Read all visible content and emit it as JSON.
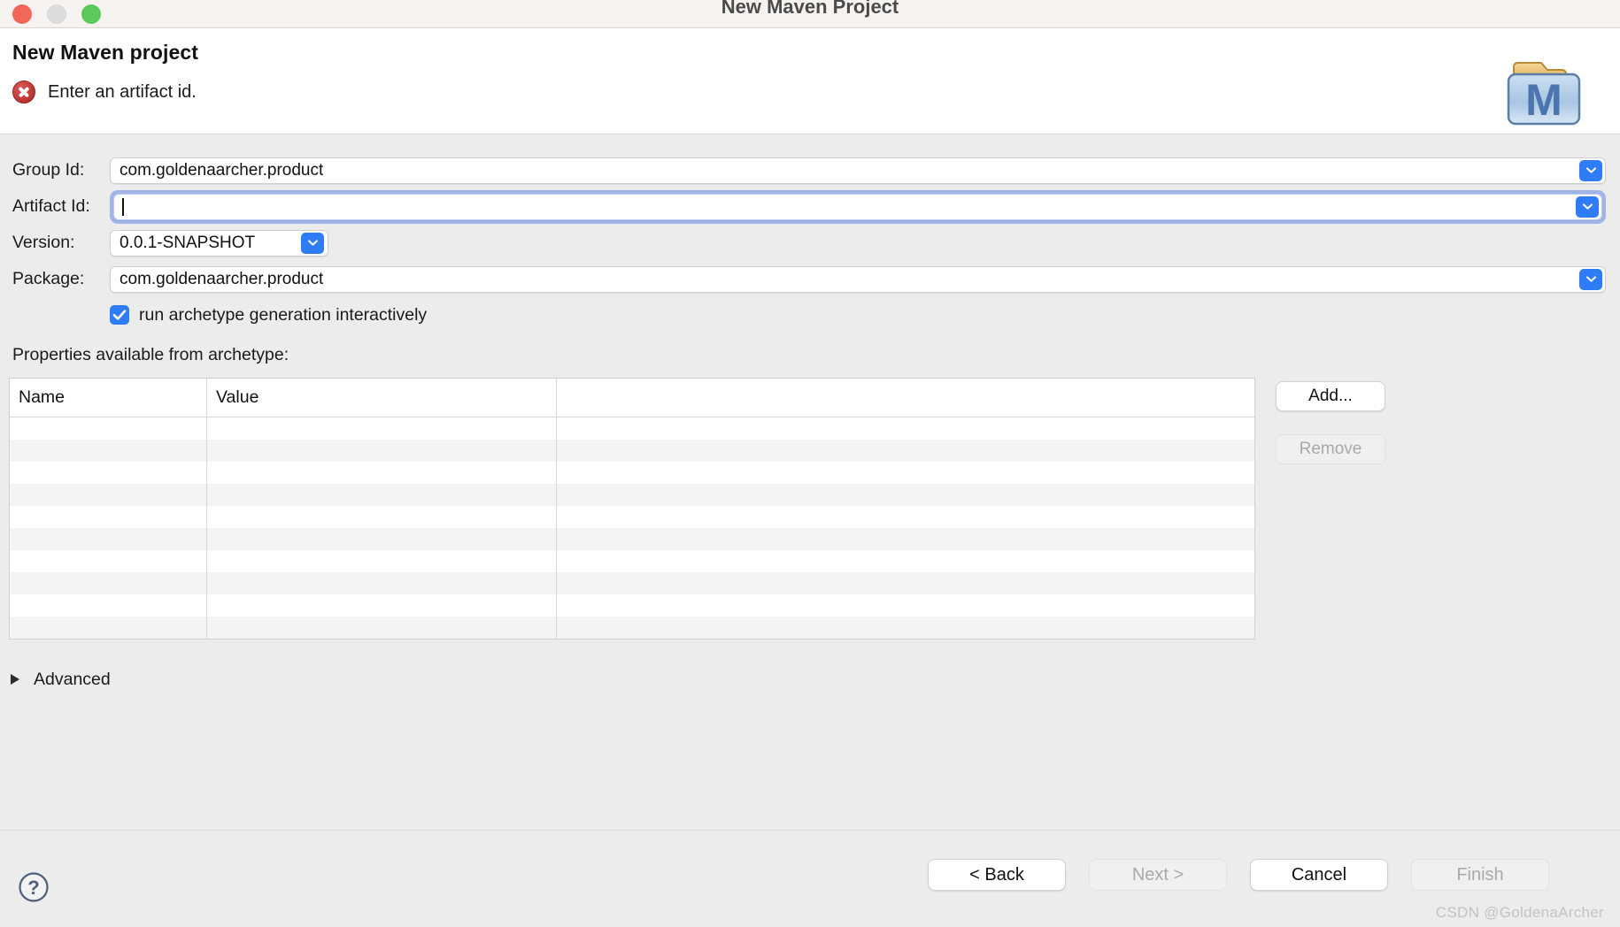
{
  "window": {
    "title": "New Maven Project",
    "traffic_lights": [
      "close-button",
      "minimize-button",
      "maximize-button"
    ]
  },
  "header": {
    "heading": "New Maven project",
    "status_icon": "error-icon",
    "status_message": "Enter an artifact id.",
    "logo_icon": "maven-folder-icon",
    "logo_letter": "M"
  },
  "form": {
    "fields": [
      {
        "label": "Group Id:",
        "value": "com.goldenaarcher.product",
        "has_dropdown": true,
        "focused": false
      },
      {
        "label": "Artifact Id:",
        "value": "",
        "has_dropdown": true,
        "focused": true
      },
      {
        "label": "Version:",
        "value": "0.0.1-SNAPSHOT",
        "has_dropdown": true,
        "focused": false
      },
      {
        "label": "Package:",
        "value": "com.goldenaarcher.product",
        "has_dropdown": true,
        "focused": false
      }
    ],
    "checkbox": {
      "label": "run archetype generation interactively",
      "checked": true
    }
  },
  "properties": {
    "section_label": "Properties available from archetype:",
    "columns": [
      "Name",
      "Value",
      ""
    ],
    "rows": [
      {
        "name": "",
        "value": "",
        "extra": ""
      },
      {
        "name": "",
        "value": "",
        "extra": ""
      },
      {
        "name": "",
        "value": "",
        "extra": ""
      },
      {
        "name": "",
        "value": "",
        "extra": ""
      },
      {
        "name": "",
        "value": "",
        "extra": ""
      },
      {
        "name": "",
        "value": "",
        "extra": ""
      },
      {
        "name": "",
        "value": "",
        "extra": ""
      },
      {
        "name": "",
        "value": "",
        "extra": ""
      },
      {
        "name": "",
        "value": "",
        "extra": ""
      },
      {
        "name": "",
        "value": "",
        "extra": ""
      }
    ],
    "add_label": "Add...",
    "remove_label": "Remove",
    "remove_enabled": false
  },
  "advanced": {
    "label": "Advanced",
    "expanded": false,
    "disclosure_icon": "triangle-right-icon"
  },
  "footer": {
    "help_icon": "help-question-icon",
    "buttons": [
      {
        "label": "< Back",
        "enabled": true
      },
      {
        "label": "Next >",
        "enabled": false
      },
      {
        "label": "Cancel",
        "enabled": true
      },
      {
        "label": "Finish",
        "enabled": false
      }
    ]
  },
  "watermark": "CSDN @GoldenaArcher",
  "colors": {
    "accent_blue": "#2f7df6",
    "focus_ring": "#7898e2",
    "error_red": "#c03a37",
    "window_bg": "#ececec",
    "titlebar_bg": "#f6f2ef"
  }
}
